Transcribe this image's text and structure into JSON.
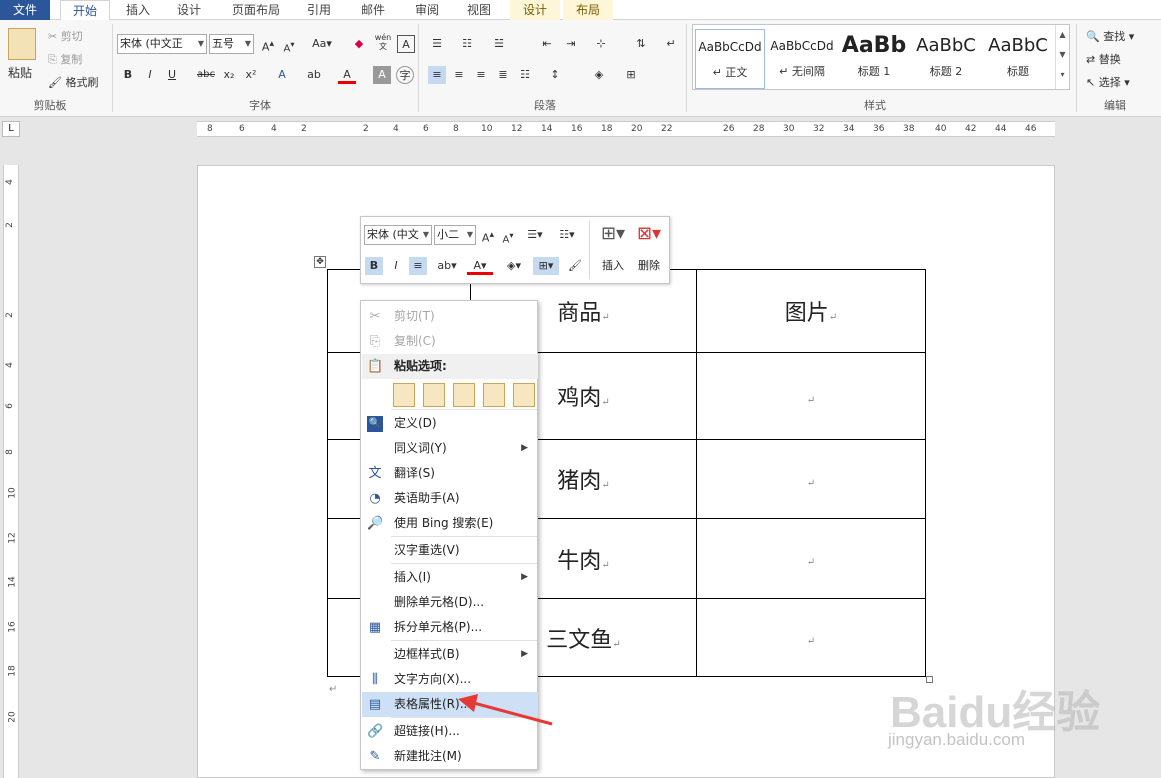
{
  "tabs": [
    {
      "label": "文件",
      "kind": "file"
    },
    {
      "label": "开始",
      "kind": "active"
    },
    {
      "label": "插入",
      "kind": ""
    },
    {
      "label": "设计",
      "kind": ""
    },
    {
      "label": "页面布局",
      "kind": ""
    },
    {
      "label": "引用",
      "kind": ""
    },
    {
      "label": "邮件",
      "kind": ""
    },
    {
      "label": "审阅",
      "kind": ""
    },
    {
      "label": "视图",
      "kind": ""
    },
    {
      "label": "设计",
      "kind": "ctx"
    },
    {
      "label": "布局",
      "kind": "ctx"
    }
  ],
  "clipboard": {
    "paste": "粘贴",
    "cut": "剪切",
    "copy": "复制",
    "format_painter": "格式刷",
    "title": "剪贴板"
  },
  "font": {
    "name": "宋体 (中文正",
    "size": "五号",
    "title": "字体",
    "case_btn": "Aa",
    "bold": "B",
    "italic": "I",
    "underline": "U",
    "strike": "abc",
    "sub": "x₂",
    "sup": "x²",
    "color_a": "A",
    "wen": "wén",
    "wen_char": "文"
  },
  "paragraph": {
    "title": "段落"
  },
  "styles": {
    "title": "样式",
    "items": [
      {
        "preview": "AaBbCcDd",
        "name": "↵ 正文"
      },
      {
        "preview": "AaBbCcDd",
        "name": "↵ 无间隔"
      },
      {
        "preview": "AaBb",
        "name": "标题 1"
      },
      {
        "preview": "AaBbC",
        "name": "标题 2"
      },
      {
        "preview": "AaBbC",
        "name": "标题"
      }
    ]
  },
  "editing": {
    "find": "查找",
    "replace": "替换",
    "select": "选择",
    "title": "编辑"
  },
  "hruler_ticks": [
    "8",
    "6",
    "4",
    "2",
    "2",
    "4",
    "6",
    "8",
    "10",
    "12",
    "14",
    "16",
    "18",
    "20",
    "22",
    "26",
    "28",
    "30",
    "32",
    "34",
    "36",
    "38",
    "40",
    "42",
    "44",
    "46"
  ],
  "vruler_ticks": [
    "4",
    "2",
    "2",
    "4",
    "6",
    "8",
    "10",
    "12",
    "14",
    "16",
    "18",
    "20"
  ],
  "table": {
    "headers": [
      "商品",
      "图片"
    ],
    "rows": [
      "鸡肉",
      "猪肉",
      "牛肉",
      "三文鱼"
    ]
  },
  "mini_toolbar": {
    "font": "宋体 (中文",
    "size": "小二",
    "bold": "B",
    "italic": "I",
    "insert": "插入",
    "delete": "删除"
  },
  "context_menu": {
    "items": [
      {
        "label": "剪切(T)",
        "icon": "✂",
        "disabled": true
      },
      {
        "label": "复制(C)",
        "icon": "⎘",
        "disabled": true
      },
      {
        "label": "粘贴选项:",
        "icon": "📋",
        "header": true
      },
      {
        "label": "定义(D)",
        "icon": "🔍"
      },
      {
        "label": "同义词(Y)",
        "icon": "",
        "submenu": true
      },
      {
        "label": "翻译(S)",
        "icon": "文"
      },
      {
        "label": "英语助手(A)",
        "icon": "◔"
      },
      {
        "label": "使用 Bing 搜索(E)",
        "icon": "🔎"
      },
      {
        "label": "汉字重选(V)",
        "icon": ""
      },
      {
        "label": "插入(I)",
        "icon": "",
        "submenu": true
      },
      {
        "label": "删除单元格(D)...",
        "icon": ""
      },
      {
        "label": "拆分单元格(P)...",
        "icon": "▦"
      },
      {
        "label": "边框样式(B)",
        "icon": "",
        "submenu": true
      },
      {
        "label": "文字方向(X)...",
        "icon": "⫼"
      },
      {
        "label": "表格属性(R)...",
        "icon": "▤",
        "highlight": true
      },
      {
        "label": "超链接(H)...",
        "icon": "🔗"
      },
      {
        "label": "新建批注(M)",
        "icon": "✎"
      }
    ]
  },
  "watermark": {
    "brand": "Baidu经验",
    "url": "jingyan.baidu.com"
  },
  "colors": {
    "accent": "#2b579a",
    "highlight": "#cde0f5",
    "arrow": "#e53935"
  }
}
